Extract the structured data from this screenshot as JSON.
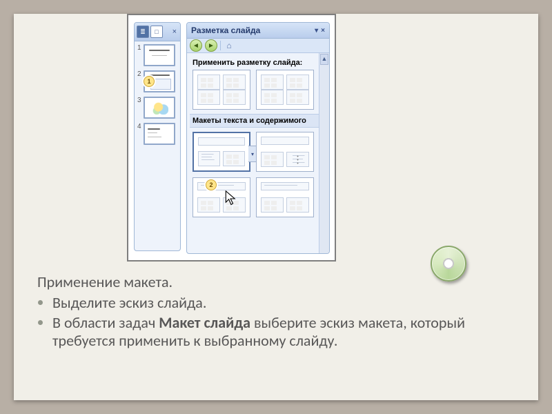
{
  "slide": {
    "title": "Применение макета.",
    "bullets": [
      {
        "text_pre": "Выделите эскиз слайда."
      },
      {
        "text_pre": "В области задач ",
        "bold": "Макет слайда",
        "text_post": " выберите эскиз макета, который требуется применить к выбранному слайду."
      }
    ]
  },
  "screenshot": {
    "thumbs": [
      "1",
      "2",
      "3",
      "4"
    ],
    "callouts": {
      "c1": "1",
      "c2": "2"
    },
    "task_pane": {
      "title": "Разметка слайда",
      "apply_heading": "Применить разметку слайда:",
      "section2": "Макеты текста и содержимого"
    },
    "icons": {
      "tab_outline": "≣",
      "tab_slides": "□",
      "close_x": "×",
      "dropdown_tri": "▾",
      "nav_back": "◄",
      "nav_fwd": "►",
      "nav_home": "⌂",
      "scroll_up": "▲",
      "scroll_down": "▼",
      "layout_dd": "▾"
    }
  }
}
